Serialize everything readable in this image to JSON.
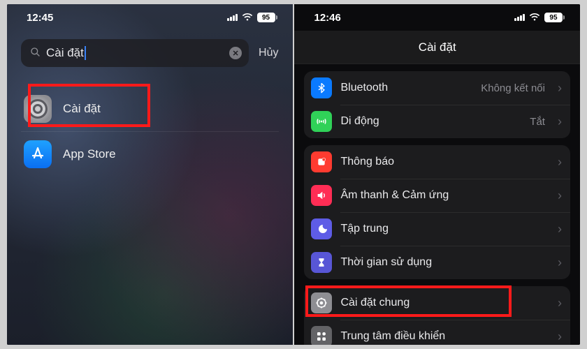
{
  "left": {
    "time": "12:45",
    "battery": "95",
    "search": {
      "query": "Cài đặt",
      "cancel": "Hủy"
    },
    "results": [
      {
        "name": "Cài đặt",
        "icon": "settings-icon"
      },
      {
        "name": "App Store",
        "icon": "appstore-icon"
      }
    ]
  },
  "right": {
    "time": "12:46",
    "battery": "95",
    "title": "Cài đặt",
    "groups": [
      {
        "rows": [
          {
            "icon": "bluetooth-icon",
            "color": "bg-blue",
            "label": "Bluetooth",
            "detail": "Không kết nối"
          },
          {
            "icon": "cellular-icon",
            "color": "bg-green",
            "label": "Di động",
            "detail": "Tắt"
          }
        ]
      },
      {
        "rows": [
          {
            "icon": "notifications-icon",
            "color": "bg-red",
            "label": "Thông báo",
            "detail": ""
          },
          {
            "icon": "sound-icon",
            "color": "bg-pink",
            "label": "Âm thanh & Cảm ứng",
            "detail": ""
          },
          {
            "icon": "focus-icon",
            "color": "bg-purple",
            "label": "Tập trung",
            "detail": ""
          },
          {
            "icon": "screentime-icon",
            "color": "bg-hourglass",
            "label": "Thời gian sử dụng",
            "detail": ""
          }
        ]
      },
      {
        "rows": [
          {
            "icon": "general-icon",
            "color": "bg-gray",
            "label": "Cài đặt chung",
            "detail": ""
          },
          {
            "icon": "control-center-icon",
            "color": "bg-gray2",
            "label": "Trung tâm điều khiển",
            "detail": ""
          }
        ]
      }
    ]
  }
}
